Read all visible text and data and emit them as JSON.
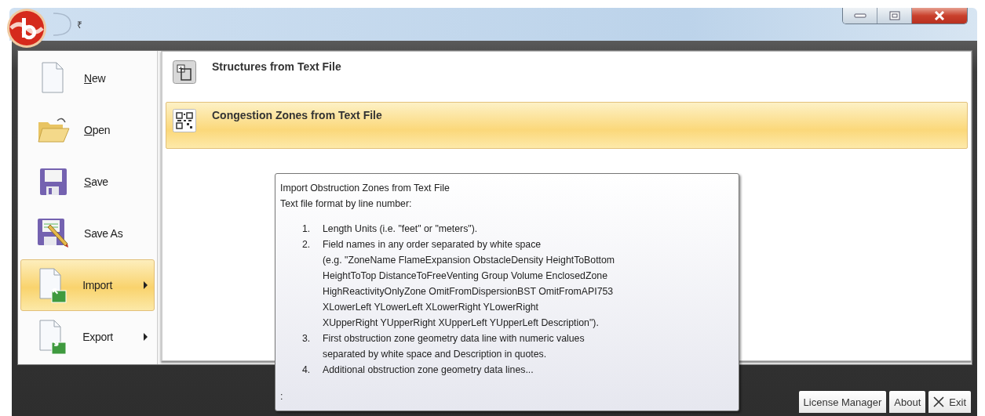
{
  "window": {
    "quick_access_symbol": "₹"
  },
  "menu": [
    {
      "label": "New",
      "kind": "new",
      "underline_first": true,
      "selected": false,
      "submenu": false
    },
    {
      "label": "Open",
      "kind": "open",
      "underline_first": true,
      "selected": false,
      "submenu": false
    },
    {
      "label": "Save",
      "kind": "save",
      "underline_first": true,
      "selected": false,
      "submenu": false
    },
    {
      "label": "Save As",
      "kind": "saveas",
      "underline_first": false,
      "selected": false,
      "submenu": false
    },
    {
      "label": "Import",
      "kind": "import",
      "underline_first": false,
      "selected": true,
      "submenu": true
    },
    {
      "label": "Export",
      "kind": "export",
      "underline_first": false,
      "selected": false,
      "submenu": true
    }
  ],
  "submenu_items": [
    {
      "label": "Structures from Text File",
      "kind": "structures",
      "selected": false
    },
    {
      "label": "Congestion Zones from Text File",
      "kind": "congestion",
      "selected": true
    }
  ],
  "tooltip": {
    "title": "Import Obstruction Zones from Text File",
    "subtitle": "Text file format by line number:",
    "steps": [
      {
        "number": "1.",
        "text": "Length Units (i.e. \"feet\" or \"meters\")."
      },
      {
        "number": "2.",
        "text": "Field names in any order separated by white space\n(e.g. \"ZoneName FlameExpansion ObstacleDensity HeightToBottom\nHeightToTop DistanceToFreeVenting Group Volume EnclosedZone\nHighReactivityOnlyZone OmitFromDispersionBST OmitFromAPI753\nXLowerLeft YLowerLeft XLowerRight YLowerRight\nXUpperRight YUpperRight XUpperLeft YUpperLeft Description\")."
      },
      {
        "number": "3.",
        "text": "First obstruction zone geometry data line with numeric values\nseparated by white space and Description in quotes."
      },
      {
        "number": "4.",
        "text": "Additional obstruction zone geometry data lines..."
      }
    ],
    "footer": ":"
  },
  "footer_buttons": [
    {
      "label": "License Manager",
      "kind": "plain"
    },
    {
      "label": "About",
      "kind": "plain"
    },
    {
      "label": "Exit",
      "kind": "exit"
    }
  ]
}
